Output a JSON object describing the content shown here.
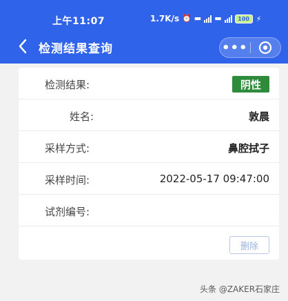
{
  "status": {
    "time": "上午11:07",
    "speed": "1.7K/s",
    "battery": "100"
  },
  "nav": {
    "title": "检测结果查询",
    "more": "•••",
    "back_icon": "chevron-left-icon",
    "close_icon": "target-circle-icon"
  },
  "result": {
    "rows": [
      {
        "label": "检测结果:",
        "value": "阴性"
      },
      {
        "label": "姓名:",
        "value": "敦晨"
      },
      {
        "label": "采样方式:",
        "value": "鼻腔拭子"
      },
      {
        "label": "采样时间:",
        "value": "2022-05-17 09:47:00"
      },
      {
        "label": "试剂编号:",
        "value": ""
      }
    ],
    "delete_label": "删除"
  },
  "colors": {
    "header": "#2f63ea",
    "badge": "#2e8b3c",
    "background": "#f2f2f2"
  },
  "watermark": "头条 @ZAKER石家庄"
}
